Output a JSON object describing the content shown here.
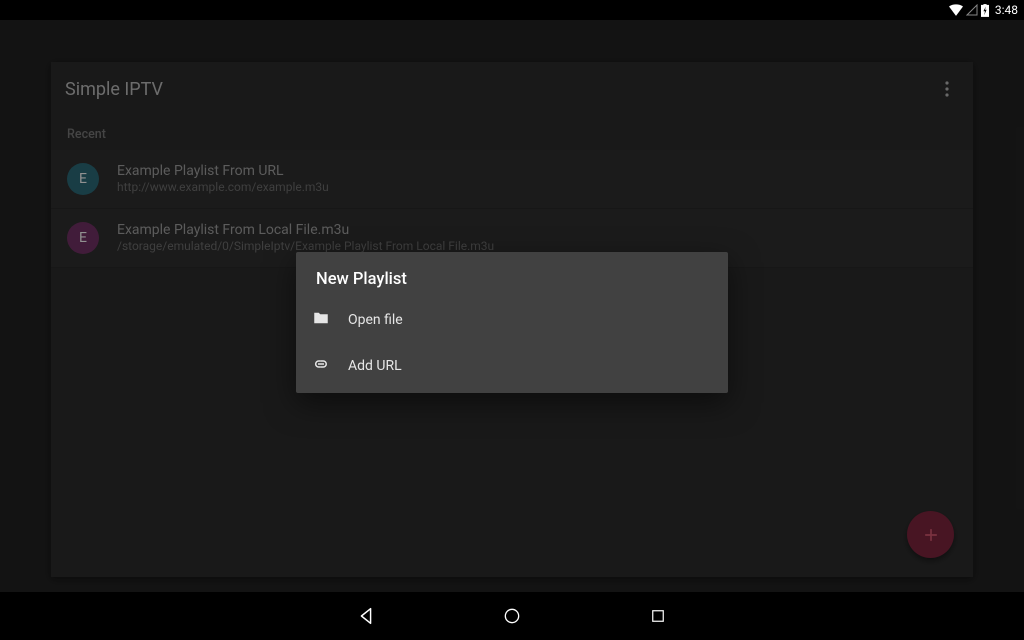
{
  "status": {
    "time": "3:48"
  },
  "app": {
    "title": "Simple IPTV",
    "sectionLabel": "Recent",
    "items": [
      {
        "initial": "E",
        "avatarColor": "#265a66",
        "title": "Example Playlist From URL",
        "subtitle": "http://www.example.com/example.m3u"
      },
      {
        "initial": "E",
        "avatarColor": "#612a56",
        "title": "Example Playlist From Local File.m3u",
        "subtitle": "/storage/emulated/0/SimpleIptv/Example Playlist From Local File.m3u"
      }
    ]
  },
  "dialog": {
    "title": "New Playlist",
    "openFile": "Open file",
    "addUrl": "Add URL"
  },
  "colors": {
    "fab": "#6b1f34"
  }
}
